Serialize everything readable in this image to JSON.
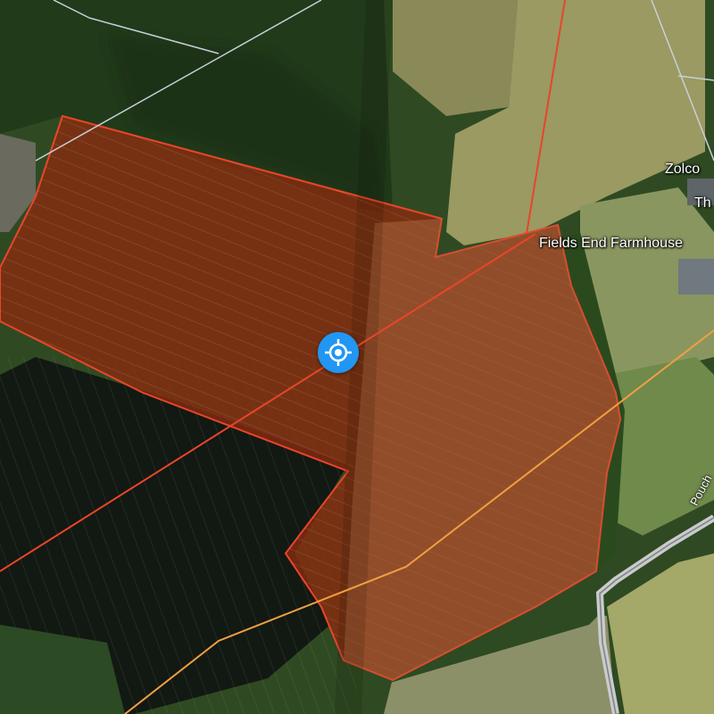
{
  "labels": {
    "zolco": "Zolco",
    "th": "Th",
    "farmhouse": "Fields End Farmhouse",
    "road": "Pouch"
  },
  "icons": {
    "locate": "crosshair-locate-icon"
  },
  "colors": {
    "parcel_outline": "#e8452a",
    "parcel_fill": "#8a2a10",
    "boundary_orange": "#f0a040",
    "boundary_gray": "#c8d0d8",
    "locate_button": "#2196f3"
  }
}
